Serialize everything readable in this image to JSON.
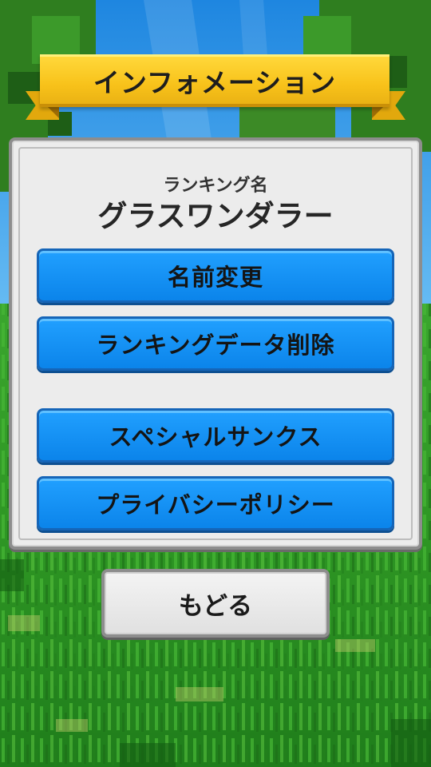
{
  "header": {
    "title": "インフォメーション"
  },
  "ranking": {
    "label": "ランキング名",
    "name": "グラスワンダラー"
  },
  "menu": [
    {
      "label": "名前変更"
    },
    {
      "label": "ランキングデータ削除"
    },
    {
      "label": "スペシャルサンクス"
    },
    {
      "label": "プライバシーポリシー"
    }
  ],
  "back": {
    "label": "もどる"
  },
  "colors": {
    "ribbon": "#f8c21a",
    "button": "#0b84ea",
    "panel": "#ececec",
    "sky": "#2f95e6",
    "grass": "#2f9a28"
  }
}
